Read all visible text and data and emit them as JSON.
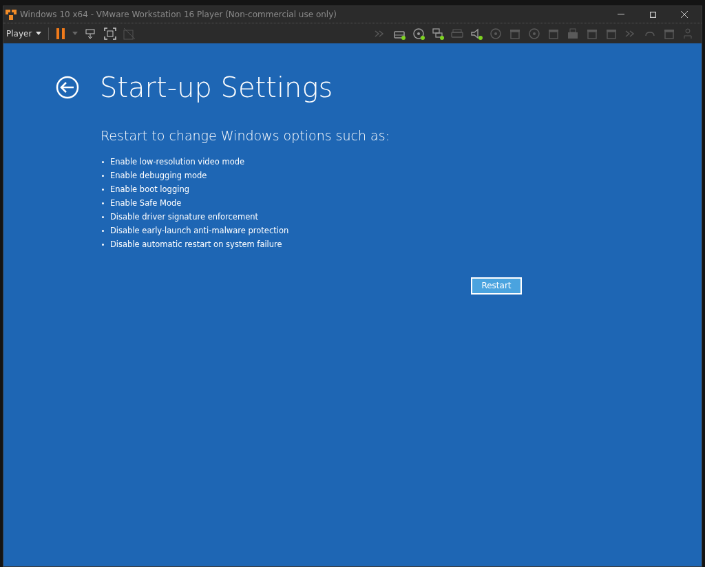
{
  "window": {
    "title": "Windows 10 x64 - VMware Workstation 16 Player (Non-commercial use only)"
  },
  "toolbar": {
    "menu": "Player",
    "paused": true
  },
  "devices": [
    {
      "kind": "arrows",
      "connected": false
    },
    {
      "kind": "drive",
      "connected": true
    },
    {
      "kind": "disc",
      "connected": true
    },
    {
      "kind": "network",
      "connected": true
    },
    {
      "kind": "printer",
      "connected": false
    },
    {
      "kind": "sound",
      "connected": true
    },
    {
      "kind": "disc",
      "connected": false
    },
    {
      "kind": "box",
      "connected": false
    },
    {
      "kind": "disc",
      "connected": false
    },
    {
      "kind": "box",
      "connected": false
    },
    {
      "kind": "usb",
      "connected": false
    },
    {
      "kind": "box",
      "connected": false
    },
    {
      "kind": "box",
      "connected": false
    },
    {
      "kind": "arrows",
      "connected": false
    },
    {
      "kind": "gamepad",
      "connected": false
    },
    {
      "kind": "box",
      "connected": false
    },
    {
      "kind": "person",
      "connected": false
    }
  ],
  "screen": {
    "title": "Start-up Settings",
    "subtitle": "Restart to change Windows options such as:",
    "options": [
      "Enable low-resolution video mode",
      "Enable debugging mode",
      "Enable boot logging",
      "Enable Safe Mode",
      "Disable driver signature enforcement",
      "Disable early-launch anti-malware protection",
      "Disable automatic restart on system failure"
    ],
    "button": "Restart"
  }
}
